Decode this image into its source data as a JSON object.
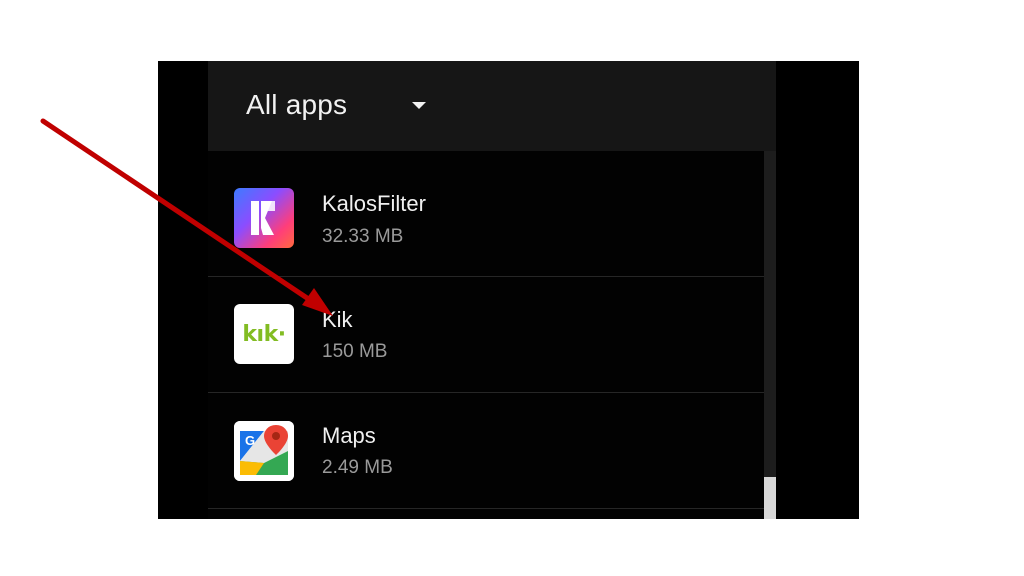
{
  "header": {
    "title": "All apps"
  },
  "apps": [
    {
      "name": "KalosFilter",
      "size": "32.33 MB",
      "icon": "kalosfilter-app-icon"
    },
    {
      "name": "Kik",
      "size": "150 MB",
      "icon": "kik-app-icon",
      "icon_text": "kık·"
    },
    {
      "name": "Maps",
      "size": "2.49 MB",
      "icon": "google-maps-app-icon",
      "icon_letter": "G"
    }
  ],
  "annotation": {
    "color": "#c00000",
    "icon": "red-arrow-icon"
  },
  "colors": {
    "screen_bg": "#000000",
    "header_bg": "#161616",
    "kik_green": "#82bc23"
  }
}
